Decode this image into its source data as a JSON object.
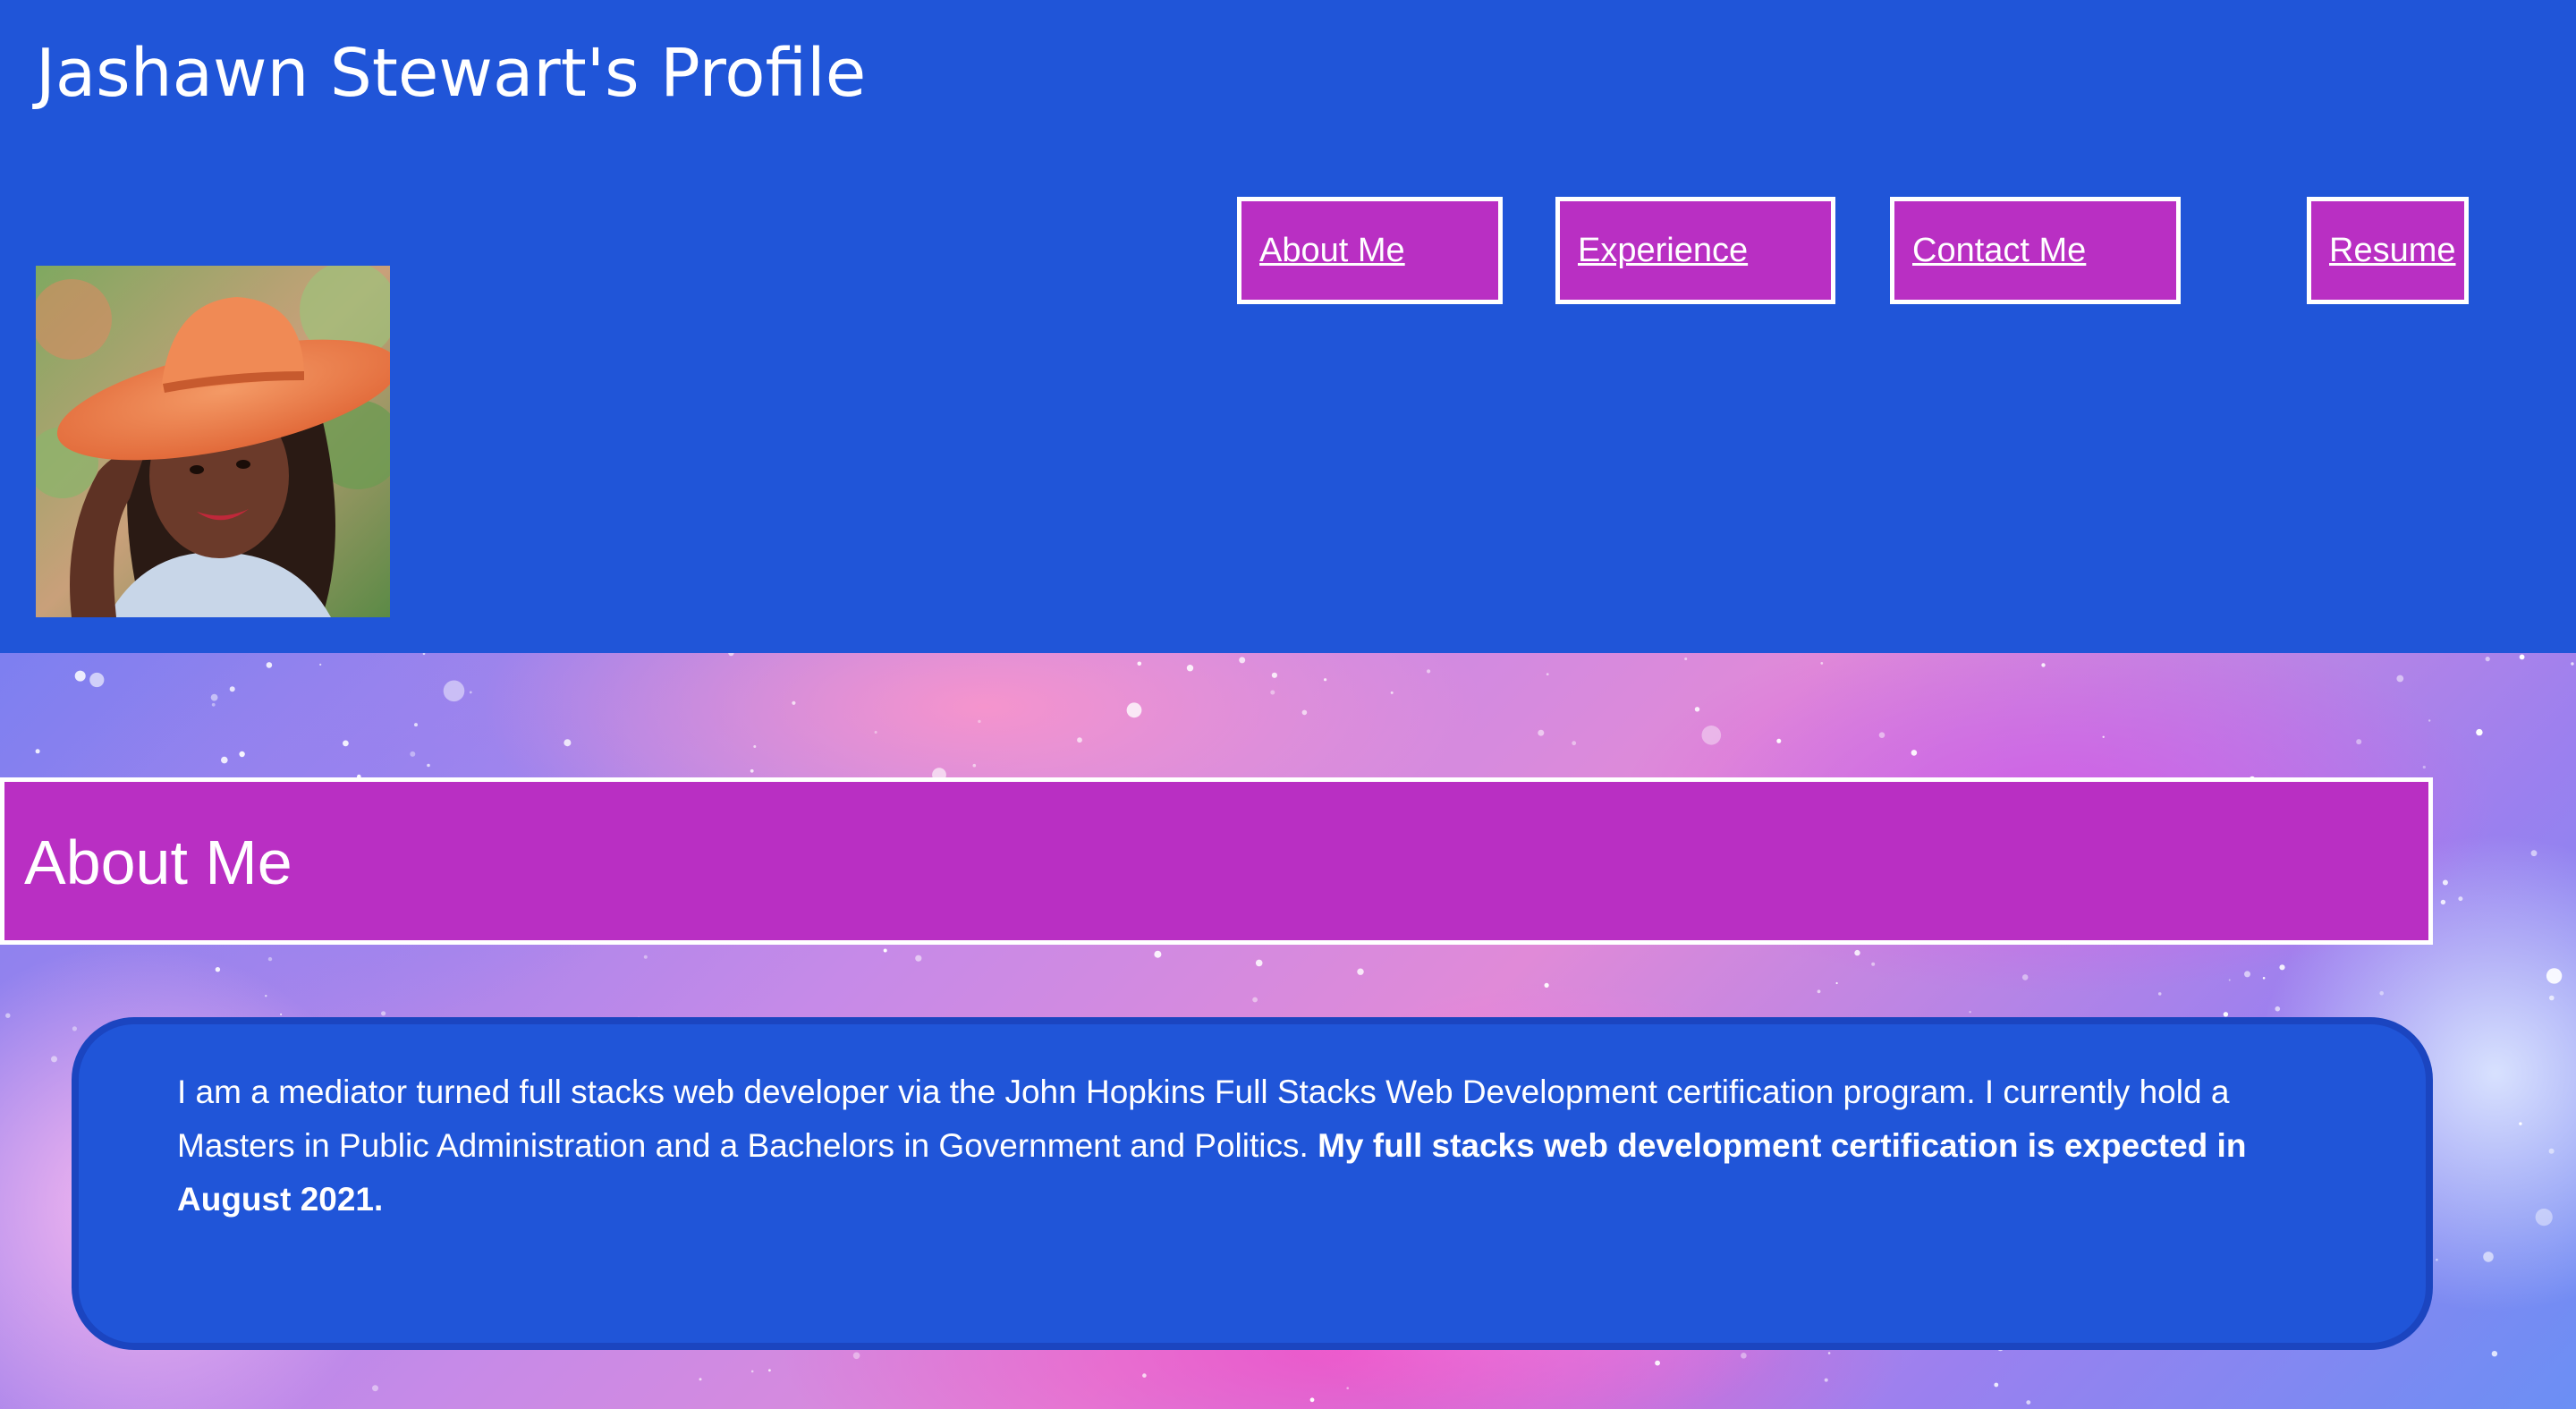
{
  "header": {
    "title": "Jashawn Stewart's Profile",
    "background_color": "#2055d8"
  },
  "avatar": {
    "icon": "profile-photo"
  },
  "nav": {
    "items": [
      {
        "label": "About Me"
      },
      {
        "label": "Experience"
      },
      {
        "label": "Contact Me"
      },
      {
        "label": "Resume"
      }
    ],
    "button_color": "#b92fc3",
    "border_color": "#ffffff"
  },
  "about": {
    "heading": "About Me",
    "bio_regular": "I am a mediator turned full stacks web developer via the John Hopkins Full Stacks Web Development certification program. I currently hold a Masters in Public Administration and a Bachelors in Government and Politics.",
    "bio_bold": "My full stacks web development certification is expected in August 2021."
  }
}
